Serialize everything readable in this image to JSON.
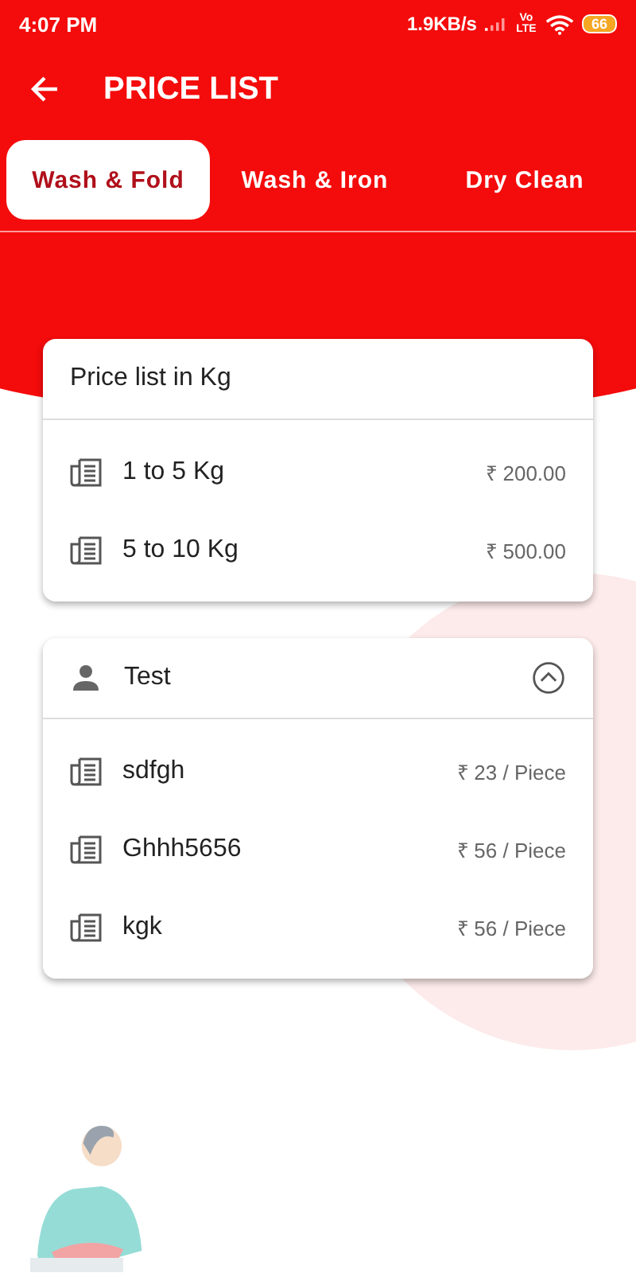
{
  "status_bar": {
    "time": "4:07 PM",
    "speed": "1.9KB/s",
    "network": "Vo LTE",
    "battery": "66"
  },
  "app_bar": {
    "title": "PRICE LIST"
  },
  "tabs": [
    {
      "label": "Wash & Fold",
      "selected": true
    },
    {
      "label": "Wash & Iron",
      "selected": false
    },
    {
      "label": "Dry Clean",
      "selected": false
    }
  ],
  "weight_card": {
    "title": "Price list in Kg",
    "rows": [
      {
        "name": "1 to 5 Kg",
        "price": "₹ 200.00"
      },
      {
        "name": "5 to 10 Kg",
        "price": "₹ 500.00"
      }
    ]
  },
  "item_card": {
    "title": "Test",
    "expanded": true,
    "rows": [
      {
        "name": "sdfgh",
        "price": "₹ 23 / Piece"
      },
      {
        "name": "Ghhh5656",
        "price": "₹ 56 / Piece"
      },
      {
        "name": "kgk",
        "price": "₹ 56 / Piece"
      }
    ]
  }
}
